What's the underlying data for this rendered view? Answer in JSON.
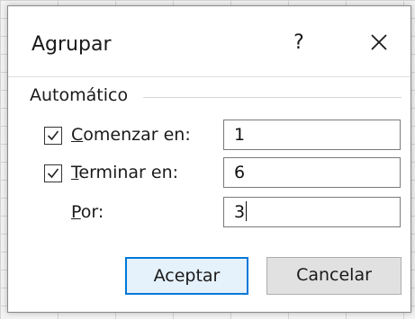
{
  "dialog": {
    "title": "Agrupar",
    "help_label": "?",
    "group_label": "Automático",
    "start": {
      "checked": true,
      "label_mnemonic": "C",
      "label_rest": "omenzar en:",
      "value": "1"
    },
    "end": {
      "checked": true,
      "label_mnemonic": "T",
      "label_rest": "erminar en:",
      "value": "6"
    },
    "by": {
      "label_mnemonic": "P",
      "label_rest": "or:",
      "value": "3"
    },
    "ok_label": "Aceptar",
    "cancel_label": "Cancelar"
  },
  "colors": {
    "accent": "#0078d7",
    "primary_button_bg": "#e5f1fb"
  },
  "icons": {
    "help": "question-mark",
    "close": "x-close",
    "check": "check-mark"
  }
}
